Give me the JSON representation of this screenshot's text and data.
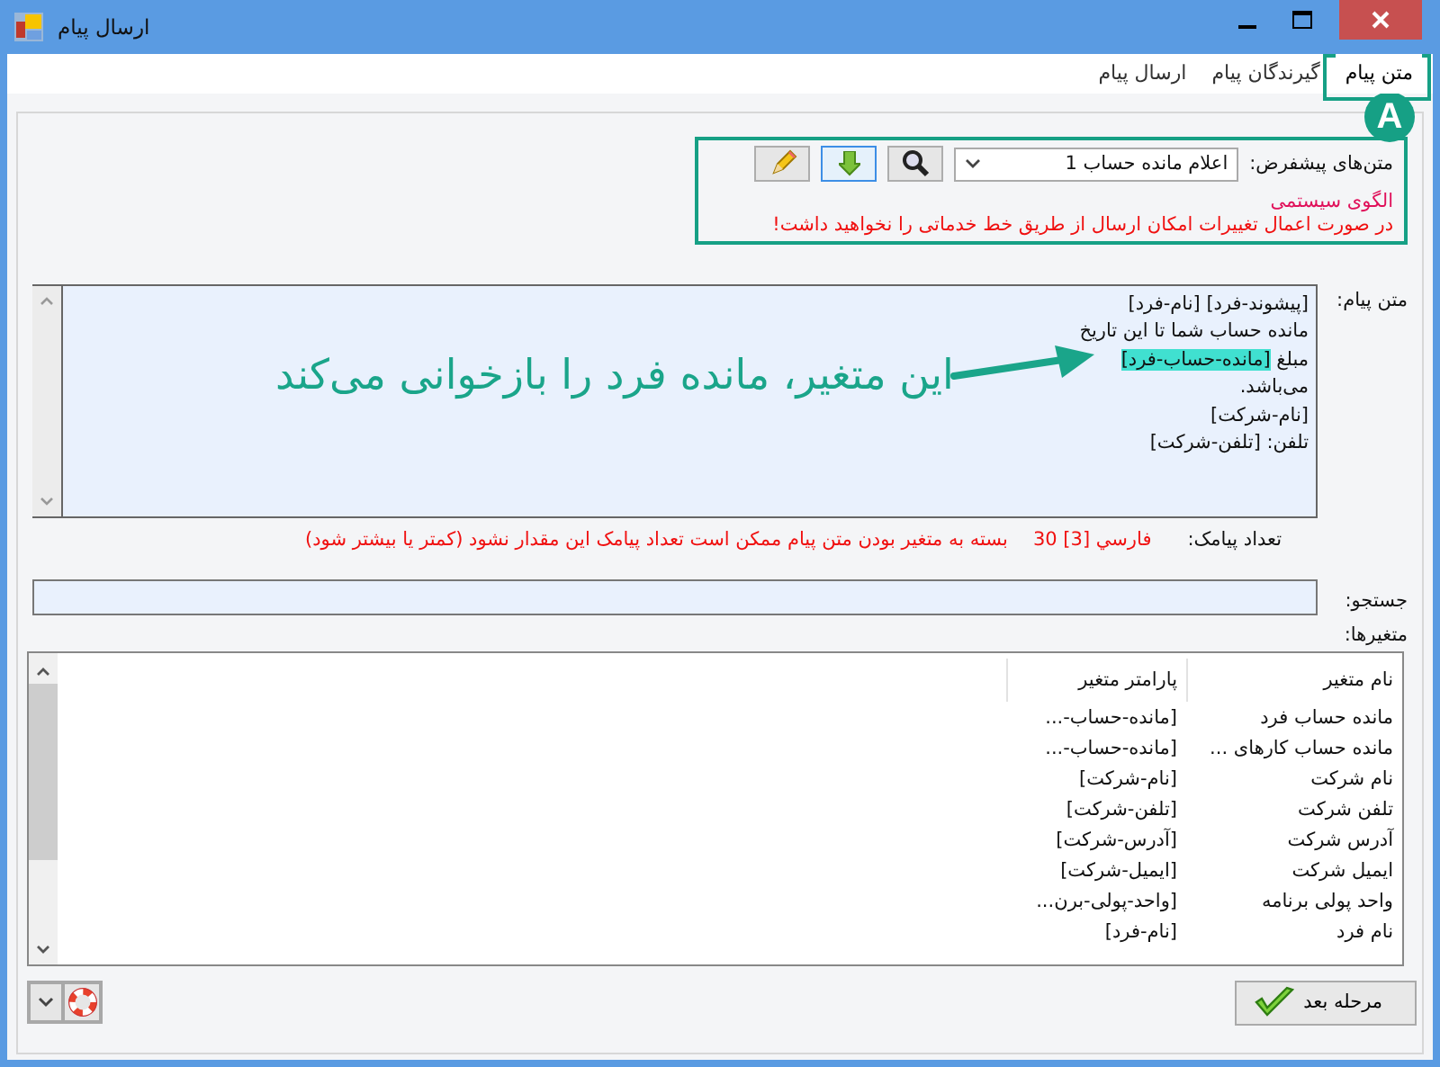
{
  "window": {
    "title": "ارسال پیام"
  },
  "tabs": [
    {
      "label": "متن پیام",
      "selected": true
    },
    {
      "label": "گیرندگان پیام",
      "selected": false
    },
    {
      "label": "ارسال پیام",
      "selected": false
    }
  ],
  "templates": {
    "label": "متن‌های پیشفرض:",
    "value": "اعلام مانده حساب 1",
    "tools": [
      {
        "kind": "search",
        "focused": false
      },
      {
        "kind": "down",
        "focused": true
      },
      {
        "kind": "edit",
        "focused": false
      }
    ],
    "type_note": "الگوی سیستمی",
    "warning": "در صورت اعمال تغییرات امکان ارسال از طریق خط خدماتی را نخواهید داشت!"
  },
  "message": {
    "label": "متن پیام:",
    "lines": [
      [
        {
          "text": "[پیشوند-فرد] [نام-فرد]",
          "highlighted": false
        }
      ],
      [
        {
          "text": "مانده حساب شما تا این تاریخ",
          "highlighted": false
        }
      ],
      [
        {
          "text": "مبلغ ",
          "highlighted": false
        },
        {
          "text": "[مانده-حساب-فرد]",
          "highlighted": true
        }
      ],
      [
        {
          "text": "می‌باشد.",
          "highlighted": false
        }
      ],
      [
        {
          "text": "[نام-شرکت]",
          "highlighted": false
        }
      ],
      [
        {
          "text": "تلفن: [تلفن-شرکت]",
          "highlighted": false
        }
      ]
    ]
  },
  "sms_count": {
    "label": "تعداد پیامک:",
    "value": "فارسي [3] 30",
    "note": "بسته به متغیر بودن متن پیام ممکن است تعداد پیامک این مقدار نشود (کمتر یا بیشتر شود)"
  },
  "search": {
    "label": "جستجو:"
  },
  "variables": {
    "label": "متغیرها:",
    "columns": [
      "نام متغیر",
      "پارامتر متغیر"
    ],
    "rows": [
      [
        "مانده حساب فرد",
        "[مانده-حساب-..."
      ],
      [
        "مانده حساب کارهای ...",
        "[مانده-حساب-..."
      ],
      [
        "نام شرکت",
        "[نام-شرکت]"
      ],
      [
        "تلفن شرکت",
        "[تلفن-شرکت]"
      ],
      [
        "آدرس شرکت",
        "[آدرس-شرکت]"
      ],
      [
        "ایمیل شرکت",
        "[ایمیل-شرکت]"
      ],
      [
        "واحد پولی برنامه",
        "[واحد-پولی-برن..."
      ],
      [
        "نام فرد",
        "[نام-فرد]"
      ]
    ]
  },
  "next_button": "مرحله بعد",
  "annotation": {
    "badge": "A",
    "callout": "این متغیر، مانده فرد را بازخوانی می‌کند"
  }
}
